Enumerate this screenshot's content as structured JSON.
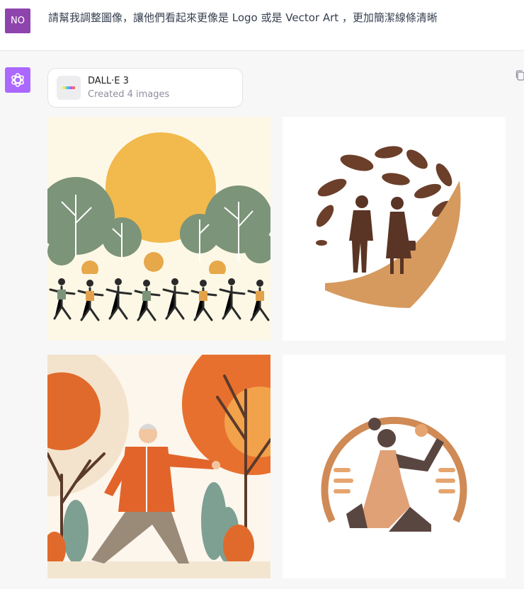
{
  "user": {
    "avatar_initials": "NO",
    "message": "請幫我調整圖像，讓他們看起來更像是 Logo 或是 Vector Art ，更加簡潔線條清晰"
  },
  "assistant": {
    "avatar_icon": "openai-logo-icon",
    "tool": {
      "icon": "dalle-rainbow-icon",
      "title": "DALL·E 3",
      "subtitle": "Created 4 images"
    },
    "images": [
      {
        "subject": "tai-chi-group-park-illustration"
      },
      {
        "subject": "elderly-couple-leaves-logo"
      },
      {
        "subject": "tai-chi-man-autumn-illustration"
      },
      {
        "subject": "meditating-woman-circle-logo"
      }
    ]
  },
  "colors": {
    "user_avatar_bg": "#8e44ad",
    "assistant_avatar_bg": "#ab68ff",
    "page_bg": "#f7f7f8"
  }
}
